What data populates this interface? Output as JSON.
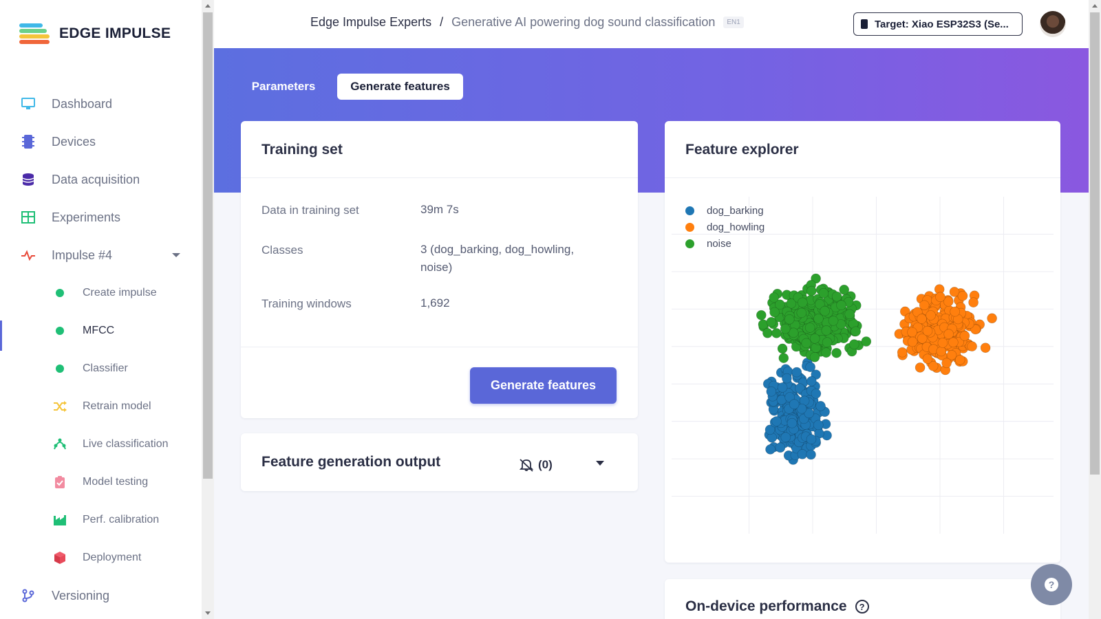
{
  "app": {
    "logo_text": "EDGE IMPULSE"
  },
  "sidebar": {
    "items": [
      {
        "label": "Dashboard",
        "icon": "monitor-icon"
      },
      {
        "label": "Devices",
        "icon": "chip-icon"
      },
      {
        "label": "Data acquisition",
        "icon": "database-icon"
      },
      {
        "label": "Experiments",
        "icon": "table-icon"
      },
      {
        "label": "Impulse #4",
        "icon": "pulse-icon"
      },
      {
        "label": "Create impulse",
        "icon": "status-dot-icon"
      },
      {
        "label": "MFCC",
        "icon": "status-dot-icon"
      },
      {
        "label": "Classifier",
        "icon": "status-dot-icon"
      },
      {
        "label": "Retrain model",
        "icon": "shuffle-icon"
      },
      {
        "label": "Live classification",
        "icon": "live-icon"
      },
      {
        "label": "Model testing",
        "icon": "clipboard-icon"
      },
      {
        "label": "Perf. calibration",
        "icon": "factory-icon"
      },
      {
        "label": "Deployment",
        "icon": "cube-icon"
      },
      {
        "label": "Versioning",
        "icon": "branch-icon"
      }
    ],
    "active_item": "MFCC"
  },
  "header": {
    "project": "Edge Impulse Experts",
    "separator": "/",
    "page": "Generative AI powering dog sound classification",
    "lang_tag": "EN1",
    "target_label": "Target: Xiao ESP32S3 (Se..."
  },
  "tabs": {
    "parameters": "Parameters",
    "generate": "Generate features"
  },
  "training_set": {
    "title": "Training set",
    "rows": [
      {
        "key": "Data in training set",
        "value": "39m 7s"
      },
      {
        "key": "Classes",
        "value": "3 (dog_barking, dog_howling, noise)"
      },
      {
        "key": "Training windows",
        "value": "1,692"
      }
    ],
    "button": "Generate features"
  },
  "output": {
    "title": "Feature generation output",
    "notification_count": "(0)"
  },
  "explorer": {
    "title": "Feature explorer"
  },
  "performance": {
    "title": "On-device performance",
    "help": "?"
  },
  "help_button": "?",
  "colors": {
    "accent": "#5a67d8",
    "dog_barking": "#1f77b4",
    "dog_howling": "#ff7f0e",
    "noise": "#2ca02c"
  },
  "chart_data": {
    "type": "scatter",
    "legend": [
      "dog_barking",
      "dog_howling",
      "noise"
    ],
    "legend_position": "top-left",
    "grid": true,
    "series": [
      {
        "name": "dog_barking",
        "color": "#1f77b4",
        "clusters": [
          {
            "cx": 0.33,
            "cy": 0.36,
            "rx": 0.06,
            "ry": 0.11,
            "n": 230
          }
        ]
      },
      {
        "name": "dog_howling",
        "color": "#ff7f0e",
        "clusters": [
          {
            "cx": 0.71,
            "cy": 0.6,
            "rx": 0.085,
            "ry": 0.09,
            "n": 260
          }
        ]
      },
      {
        "name": "noise",
        "color": "#2ca02c",
        "clusters": [
          {
            "cx": 0.38,
            "cy": 0.63,
            "rx": 0.1,
            "ry": 0.09,
            "n": 280
          }
        ]
      }
    ]
  }
}
